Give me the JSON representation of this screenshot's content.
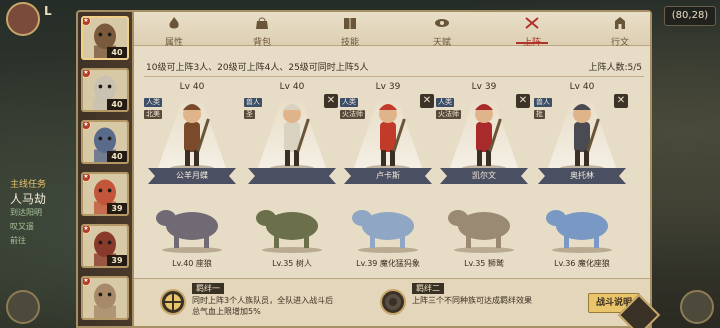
{
  "world": {
    "title_fragment": "L",
    "quest": {
      "header": "主线任务",
      "main": "人马劫",
      "sub1": "到达阳明",
      "sub2": "叹又遥",
      "sub3": "前往"
    },
    "coords": "(80,28)"
  },
  "roster": [
    {
      "level": "40",
      "hue": "#7a5a3c"
    },
    {
      "level": "40",
      "hue": "#c9c2b2"
    },
    {
      "level": "40",
      "hue": "#5a6a8a"
    },
    {
      "level": "39",
      "hue": "#c2553a"
    },
    {
      "level": "39",
      "hue": "#8a3a2a"
    },
    {
      "level": "",
      "hue": "#a88a6a"
    }
  ],
  "tabs": [
    {
      "label": "属性",
      "icon": "flame-icon"
    },
    {
      "label": "背包",
      "icon": "bag-icon"
    },
    {
      "label": "技能",
      "icon": "book-icon"
    },
    {
      "label": "天赋",
      "icon": "eye-icon"
    },
    {
      "label": "上阵",
      "icon": "swords-icon",
      "active": true
    },
    {
      "label": "行文",
      "icon": "tower-icon"
    }
  ],
  "lineup": {
    "limit_text": "10级可上阵3人、20级可上阵4人、25级可同时上阵5人",
    "count_text": "上阵人数:5/5",
    "members": [
      {
        "level": "Lv 40",
        "tag": "人类",
        "tag2": "北美",
        "name": "公羊月蝶",
        "pet_level": "Lv.40",
        "pet": "座狼",
        "has_x": false,
        "hue": "#7a4a2a",
        "pet_hue": "#6f6a74"
      },
      {
        "level": "Lv 40",
        "tag": "兽人",
        "tag2": "圣",
        "name": "",
        "pet_level": "Lv.35",
        "pet": "树人",
        "has_x": true,
        "hue": "#d9d2c0",
        "pet_hue": "#6b6f4a"
      },
      {
        "level": "Lv 39",
        "tag": "人类",
        "tag2": "火法师",
        "name": "卢卡斯",
        "pet_level": "Lv.39",
        "pet": "魔化猛犸象",
        "has_x": true,
        "hue": "#c23a2a",
        "pet_hue": "#8fa6c4"
      },
      {
        "level": "Lv 39",
        "tag": "人类",
        "tag2": "火法师",
        "name": "凯尔文",
        "pet_level": "Lv.35",
        "pet": "狮鹫",
        "has_x": true,
        "hue": "#a82a2a",
        "pet_hue": "#9a8a74"
      },
      {
        "level": "Lv 40",
        "tag": "兽人",
        "tag2": "批",
        "name": "奥托林",
        "pet_level": "Lv.36",
        "pet": "魔化座狼",
        "has_x": true,
        "hue": "#4a4a52",
        "pet_hue": "#7a98c4"
      }
    ]
  },
  "bonds": [
    {
      "tag": "羁绊一",
      "text1": "同时上阵3个人族队员，全队进入战斗后",
      "text2": "总气血上限增加5%"
    },
    {
      "tag": "羁绊二",
      "text1": "上阵三个不同种族可达成羁绊效果",
      "text2": ""
    }
  ],
  "fight_button": "战斗说明"
}
